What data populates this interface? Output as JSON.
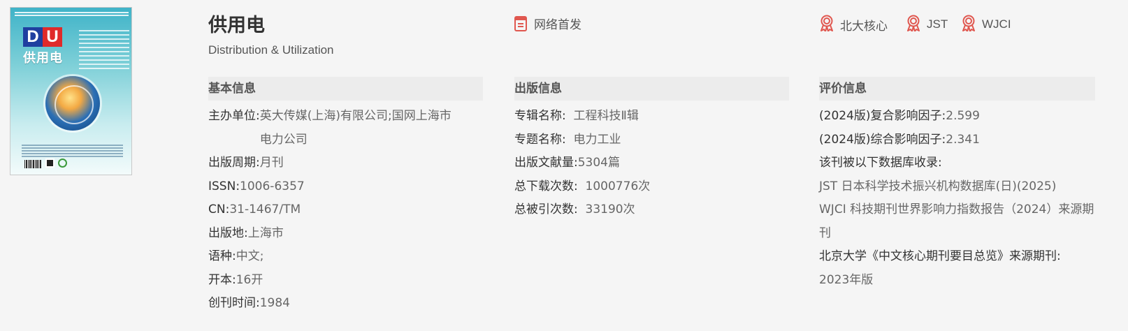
{
  "cover": {
    "logo_letters": [
      "D",
      "U"
    ],
    "title_cn": "供用电"
  },
  "header": {
    "title_cn": "供用电",
    "title_en": "Distribution & Utilization",
    "network_first": "网络首发",
    "badges": [
      "北大核心",
      "JST",
      "WJCI"
    ]
  },
  "basic_info": {
    "heading": "基本信息",
    "sponsor_label": "主办单位:",
    "sponsor_value": "英大传媒(上海)有限公司;国网上海市电力公司",
    "period_label": "出版周期:",
    "period_value": "月刊",
    "issn_label": "ISSN:",
    "issn_value": "1006-6357",
    "cn_label": "CN:",
    "cn_value": "31-1467/TM",
    "place_label": "出版地:",
    "place_value": "上海市",
    "language_label": "语种:",
    "language_value": "中文;",
    "format_label": "开本:",
    "format_value": "16开",
    "founded_label": "创刊时间:",
    "founded_value": "1984"
  },
  "publish_info": {
    "heading": "出版信息",
    "album_label": "专辑名称:",
    "album_value": "工程科技Ⅱ辑",
    "topic_label": "专题名称:",
    "topic_value": "电力工业",
    "docs_label": "出版文献量:",
    "docs_value": "5304篇",
    "downloads_label": "总下载次数:",
    "downloads_value": "1000776次",
    "citations_label": "总被引次数:",
    "citations_value": "33190次"
  },
  "evaluation_info": {
    "heading": "评价信息",
    "composite_if_label": "(2024版)复合影响因子:",
    "composite_if_value": "2.599",
    "overall_if_label": "(2024版)综合影响因子:",
    "overall_if_value": "2.341",
    "indexed_label": "该刊被以下数据库收录:",
    "db_jst": "JST 日本科学技术振兴机构数据库(日)(2025)",
    "db_wjci": "WJCI 科技期刊世界影响力指数报告（2024）来源期刊",
    "pku_label": "北京大学《中文核心期刊要目总览》来源期刊:",
    "pku_value": "2023年版"
  },
  "colors": {
    "accent_red": "#e0574f",
    "section_bg": "#ececec",
    "page_bg": "#f5f5f5"
  }
}
